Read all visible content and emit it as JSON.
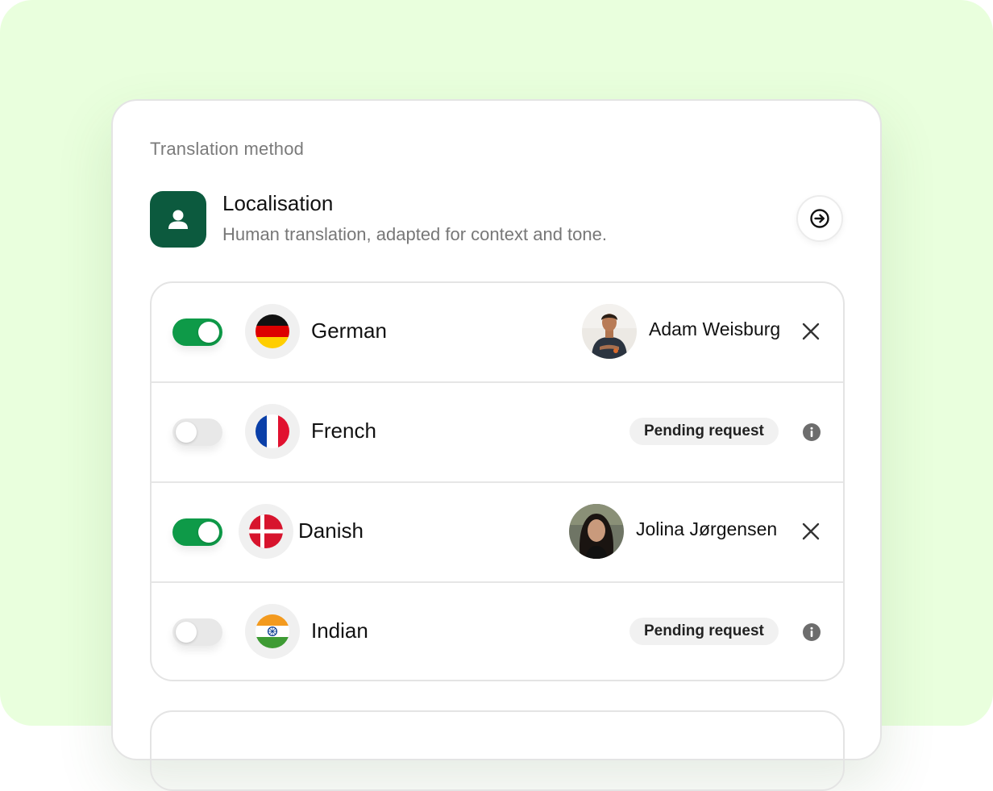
{
  "section_label": "Translation method",
  "method": {
    "icon": "person-icon",
    "title": "Localisation",
    "description": "Human translation, adapted for context and tone.",
    "action_icon": "arrow-right-circle-icon"
  },
  "languages": [
    {
      "name": "German",
      "enabled": true,
      "flag_icon": "germany-flag-icon",
      "assignee": "Adam Weisburg",
      "action_icon": "close-icon"
    },
    {
      "name": "French",
      "enabled": false,
      "flag_icon": "france-flag-icon",
      "status": "Pending request",
      "status_icon": "info-icon"
    },
    {
      "name": "Danish",
      "enabled": true,
      "flag_icon": "denmark-flag-icon",
      "assignee": "Jolina Jørgensen",
      "action_icon": "close-icon"
    },
    {
      "name": "Indian",
      "enabled": false,
      "flag_icon": "india-flag-icon",
      "status": "Pending request",
      "status_icon": "info-icon"
    }
  ],
  "colors": {
    "background": "#e9ffdd",
    "accent": "#0c5a3e",
    "toggle_on": "#0e9a48",
    "toggle_off": "#e8e8e8"
  }
}
